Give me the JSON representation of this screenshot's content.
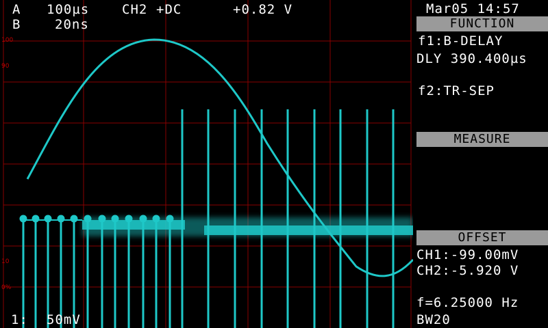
{
  "top_status": {
    "channel_a": "A",
    "timebase_a": "100µs",
    "source": "CH2",
    "coupling": "+DC",
    "trigger_level": "+0.82 V",
    "channel_b": "B",
    "timebase_b": "20ns"
  },
  "bottom_status": {
    "channel": "1:",
    "scale": "50mV"
  },
  "scale_marks": [
    "100",
    "90",
    "10",
    "0%"
  ],
  "side_panel": {
    "datetime": "Mar05 14:57",
    "function_header": "FUNCTION",
    "f1_label": "f1:B-DELAY",
    "f1_value": "DLY 390.400µs",
    "f2_label": "f2:TR-SEP",
    "measure_header": "MEASURE",
    "offset_header": "OFFSET",
    "ch1_offset": "CH1:-99.00mV",
    "ch2_offset": "CH2:-5.920 V",
    "frequency": "f=6.25000 Hz",
    "bandwidth": "BW20"
  },
  "colors": {
    "trace": "#1ec8c8",
    "grid": "#8a0000",
    "header_bg": "#9a9a9a"
  }
}
